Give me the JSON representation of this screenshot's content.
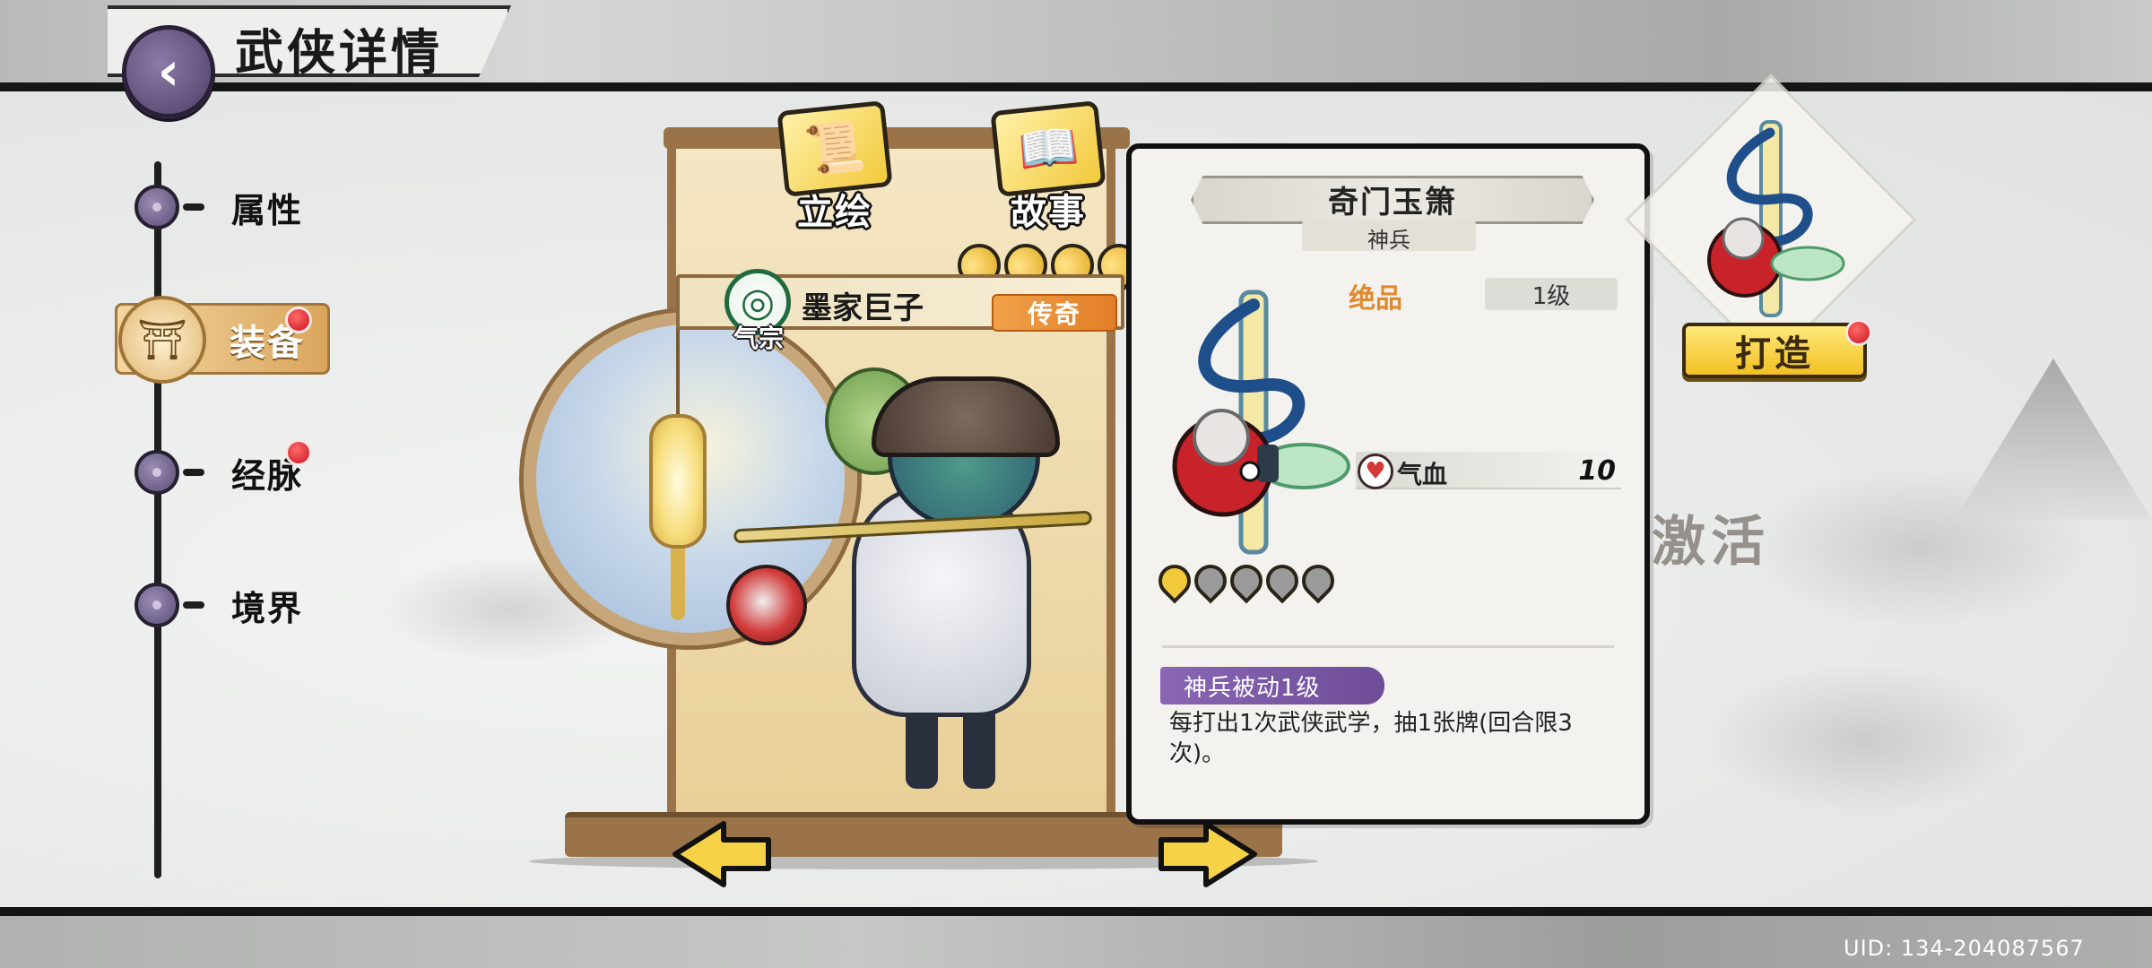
{
  "header": {
    "title": "武侠详情",
    "back_icon": "back-arrow-icon"
  },
  "nav": {
    "items": [
      {
        "label": "属性",
        "active": false,
        "badge": false
      },
      {
        "label": "装备",
        "active": true,
        "badge": true
      },
      {
        "label": "经脉",
        "active": false,
        "badge": true
      },
      {
        "label": "境界",
        "active": false,
        "badge": false
      }
    ]
  },
  "tabs": [
    {
      "label": "立绘",
      "icon": "scroll-icon"
    },
    {
      "label": "故事",
      "icon": "book-icon"
    }
  ],
  "hero": {
    "name": "墨家巨子",
    "sect": "气宗",
    "rarity": "传奇",
    "stars": 4
  },
  "equipment": {
    "name": "奇门玉箫",
    "type": "神兵",
    "grade": "绝品",
    "level": "1级",
    "stat": {
      "name": "气血",
      "value": "10",
      "icon": "heart-icon"
    },
    "stars_total": 5,
    "stars_filled": 1,
    "skill_tag": "神兵被动1级",
    "skill_desc": "每打出1次武侠武学，抽1张牌(回合限3次)。"
  },
  "forge": {
    "label": "打造",
    "badge": true
  },
  "background": {
    "text_1": "激活"
  },
  "uid": "UID: 134-204087567",
  "colors": {
    "rarity_orange": "#e37e27",
    "grade_orange": "#e08a2e",
    "skill_purple": "#6d4c98",
    "forge_yellow": "#f2c022",
    "badge_red": "#c8141c"
  }
}
